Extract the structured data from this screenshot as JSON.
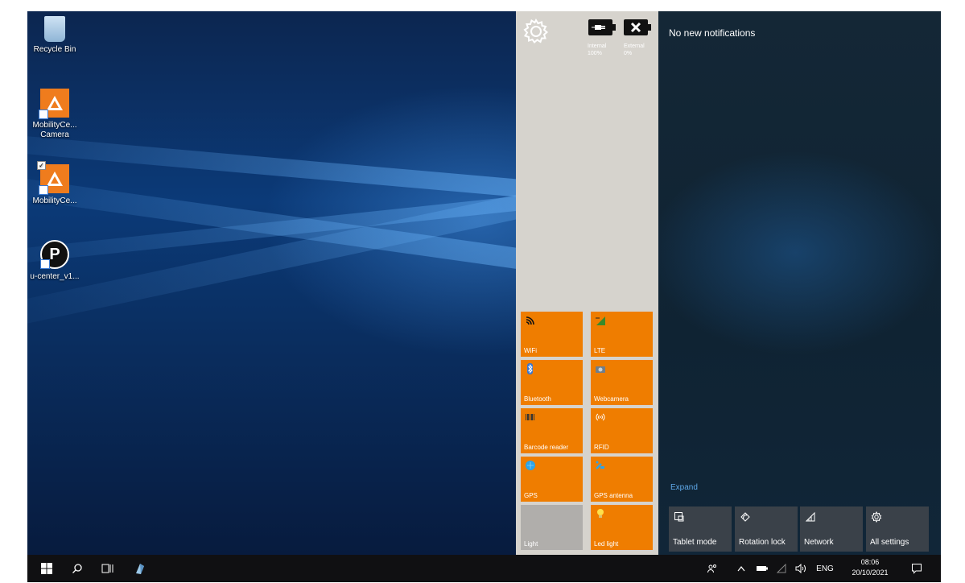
{
  "desktop": {
    "icons": [
      {
        "label": "Recycle Bin",
        "icon": "recycle-bin-icon"
      },
      {
        "label": "MobilityCe... Camera",
        "label_l1": "MobilityCe...",
        "label_l2": "Camera",
        "icon": "mobility-center-camera-icon"
      },
      {
        "label": "MobilityCe...",
        "icon": "mobility-center-icon"
      },
      {
        "label": "u-center_v1...",
        "icon": "u-center-icon",
        "glyph": "P"
      }
    ]
  },
  "mobility_center": {
    "battery_internal": {
      "label": "Internal",
      "value": "100%",
      "icon": "battery-plug-icon"
    },
    "battery_external": {
      "label": "External",
      "value": "0%",
      "icon": "battery-none-icon"
    },
    "tiles": [
      {
        "label": "WiFi",
        "icon": "wifi-icon",
        "active": true
      },
      {
        "label": "LTE",
        "icon": "lte-icon",
        "active": true
      },
      {
        "label": "Bluetooth",
        "icon": "bluetooth-icon",
        "active": true
      },
      {
        "label": "Webcamera",
        "icon": "webcamera-icon",
        "active": true
      },
      {
        "label": "Barcode reader",
        "icon": "barcode-icon",
        "active": true
      },
      {
        "label": "RFID",
        "icon": "rfid-icon",
        "active": true
      },
      {
        "label": "GPS",
        "icon": "gps-icon",
        "active": true
      },
      {
        "label": "GPS antenna",
        "icon": "gps-antenna-icon",
        "active": true
      },
      {
        "label": "Light",
        "icon": "",
        "active": false
      },
      {
        "label": "Led light",
        "icon": "led-light-icon",
        "active": true
      }
    ],
    "tile_color": "#ef7d00"
  },
  "action_center": {
    "no_notifications": "No new notifications",
    "expand": "Expand",
    "quick_actions": [
      {
        "label": "Tablet mode",
        "icon": "tablet-mode-icon"
      },
      {
        "label": "Rotation lock",
        "icon": "rotation-lock-icon"
      },
      {
        "label": "Network",
        "icon": "network-icon"
      },
      {
        "label": "All settings",
        "icon": "settings-icon"
      }
    ]
  },
  "taskbar": {
    "language": "ENG",
    "time": "08:06",
    "date": "20/10/2021"
  }
}
